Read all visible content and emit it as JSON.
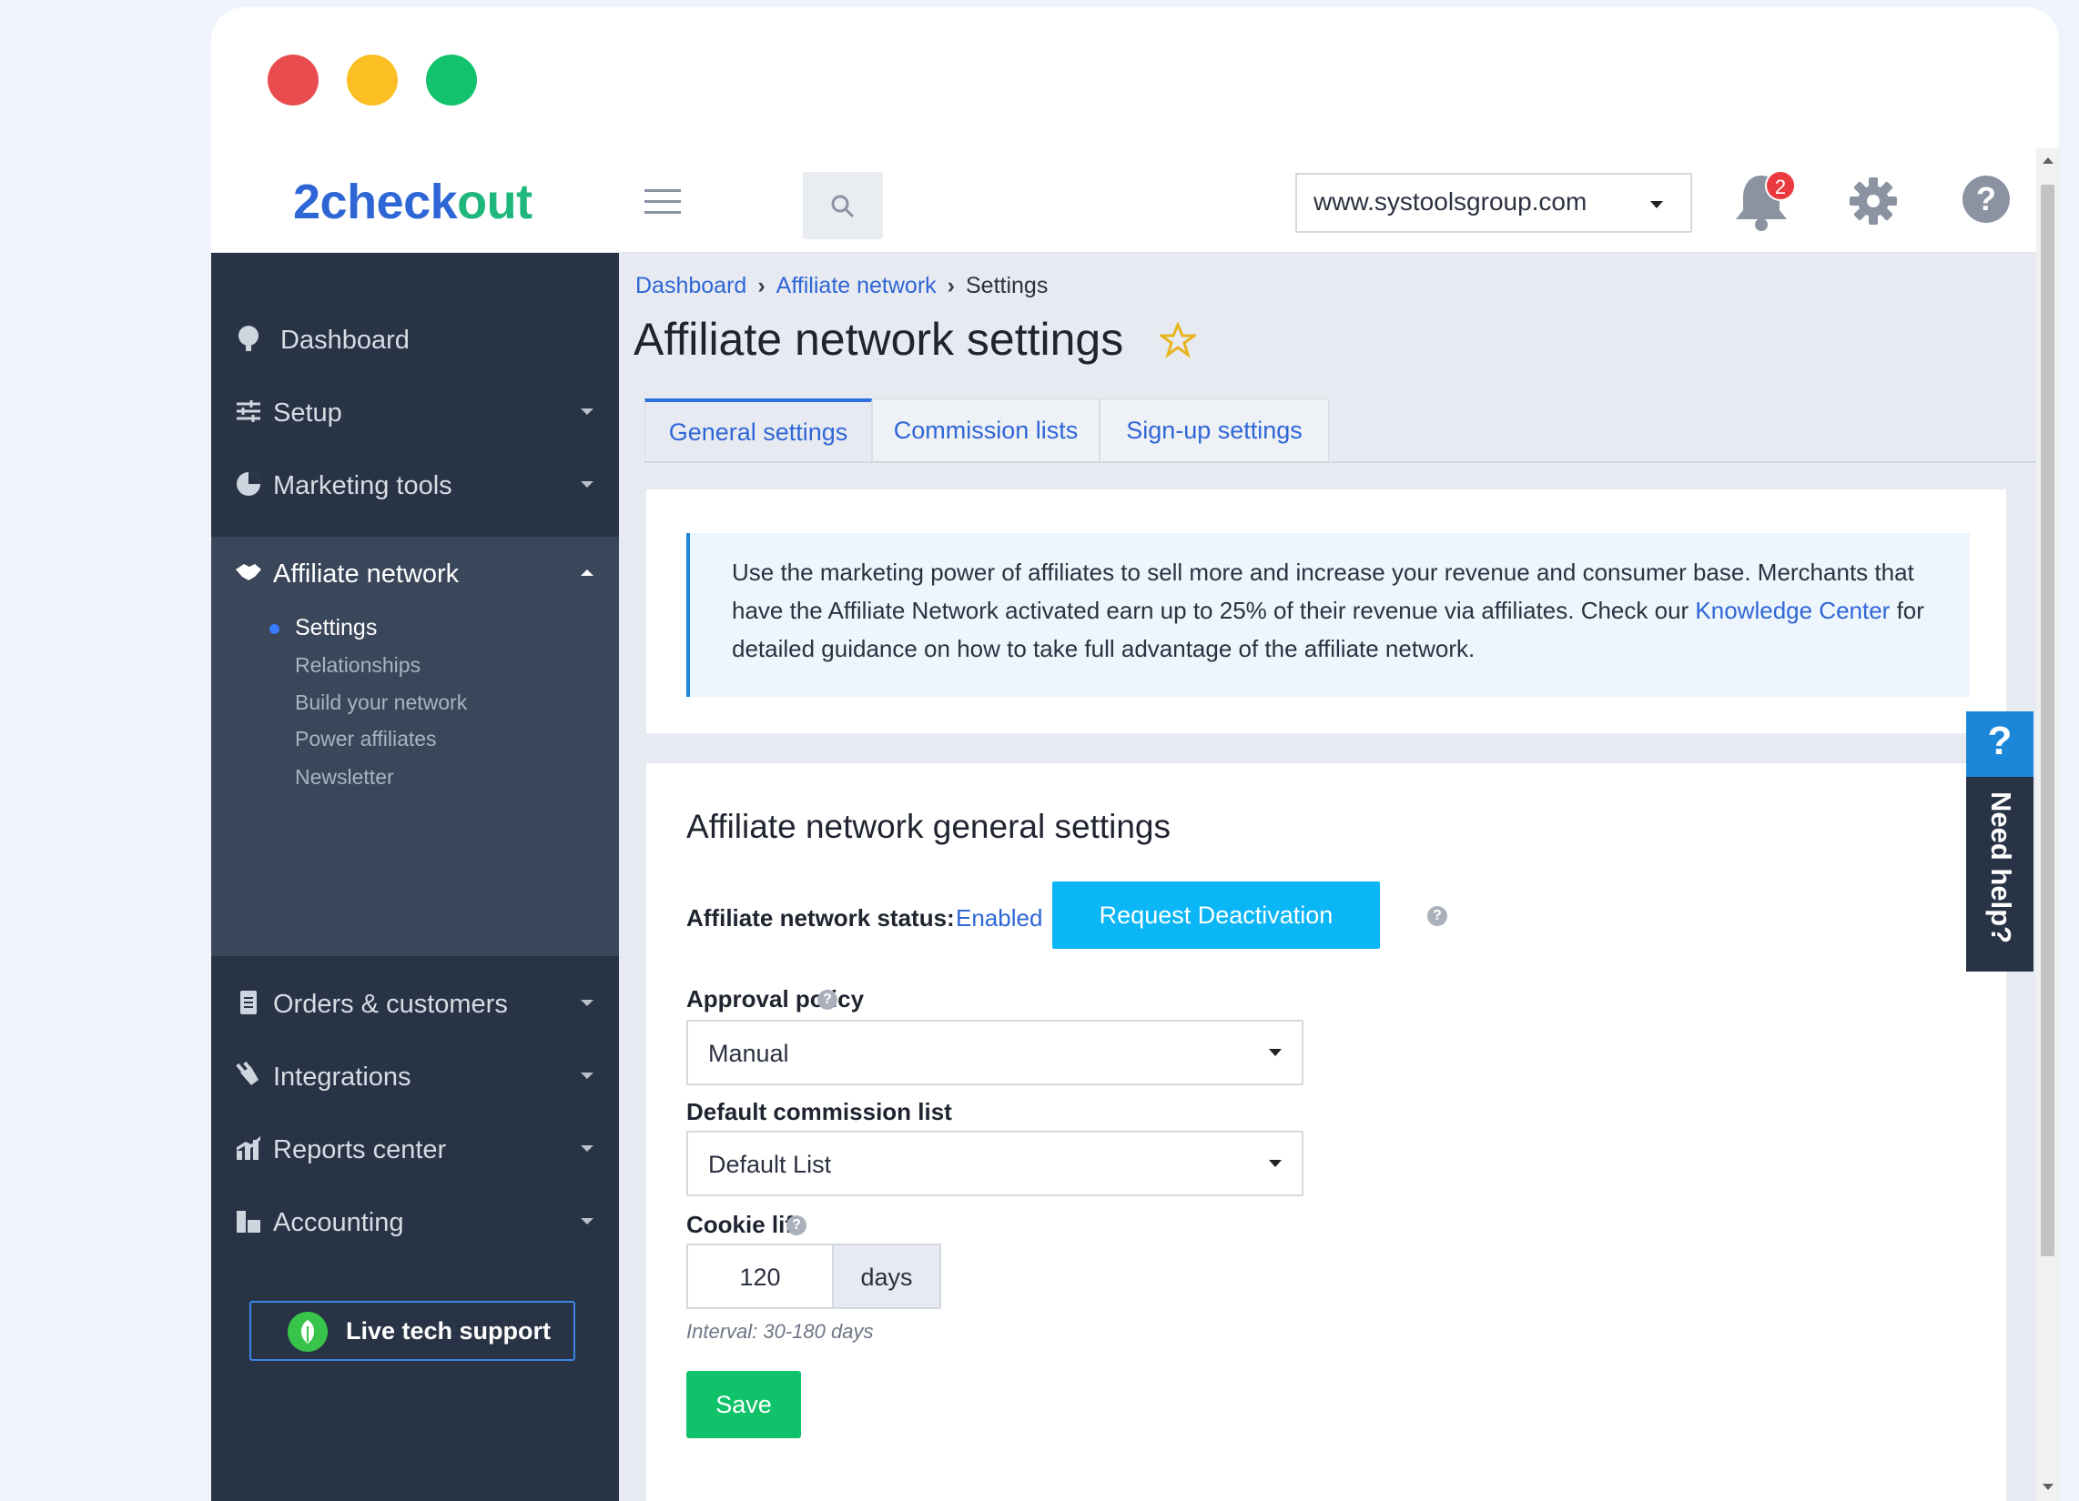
{
  "window": {
    "controls": [
      "close",
      "minimize",
      "maximize"
    ]
  },
  "header": {
    "logo_part1": "2check",
    "logo_part2": "out",
    "domain": "www.systoolsgroup.com",
    "notification_count": "2",
    "icons": [
      "menu-icon",
      "search-icon",
      "bell-icon",
      "gear-icon",
      "help-icon"
    ]
  },
  "sidebar": {
    "items": [
      {
        "label": "Dashboard",
        "icon": "dashboard-icon"
      },
      {
        "label": "Setup",
        "icon": "sliders-icon"
      },
      {
        "label": "Marketing tools",
        "icon": "pie-icon"
      },
      {
        "label": "Affiliate network",
        "icon": "handshake-icon"
      },
      {
        "label": "Orders & customers",
        "icon": "document-icon"
      },
      {
        "label": "Integrations",
        "icon": "plug-icon"
      },
      {
        "label": "Reports center",
        "icon": "chart-icon"
      },
      {
        "label": "Accounting",
        "icon": "ledger-icon"
      }
    ],
    "submenu": [
      "Settings",
      "Relationships",
      "Build your network",
      "Power affiliates",
      "Newsletter"
    ],
    "live_support": "Live tech support"
  },
  "breadcrumb": {
    "items": [
      "Dashboard",
      "Affiliate network",
      "Settings"
    ]
  },
  "page": {
    "title": "Affiliate network settings"
  },
  "tabs": [
    "General settings",
    "Commission lists",
    "Sign-up settings"
  ],
  "info": {
    "text1": "Use the marketing power of affiliates to sell more and increase your revenue and consumer base. Merchants that have the Affiliate Network activated earn up to 25% of their revenue via affiliates. Check our ",
    "link": "Knowledge Center",
    "text2": " for detailed guidance on how to take full advantage of the affiliate network."
  },
  "settings": {
    "title": "Affiliate network general settings",
    "status_label": "Affiliate network status:",
    "status_value": "Enabled",
    "deactivate_label": "Request Deactivation",
    "approval_label": "Approval policy",
    "approval_value": "Manual",
    "commission_label": "Default commission list",
    "commission_value": "Default List",
    "cookie_label": "Cookie life",
    "cookie_value": "120",
    "cookie_unit": "days",
    "cookie_hint": "Interval: 30-180 days",
    "save_label": "Save"
  },
  "need_help": {
    "q": "?",
    "label": "Need help?"
  },
  "colors": {
    "accent": "#2f66d6",
    "brand_green": "#1fb77b",
    "sidebar": "#283345",
    "save": "#10c36a",
    "deactivate": "#0bb6f6"
  }
}
